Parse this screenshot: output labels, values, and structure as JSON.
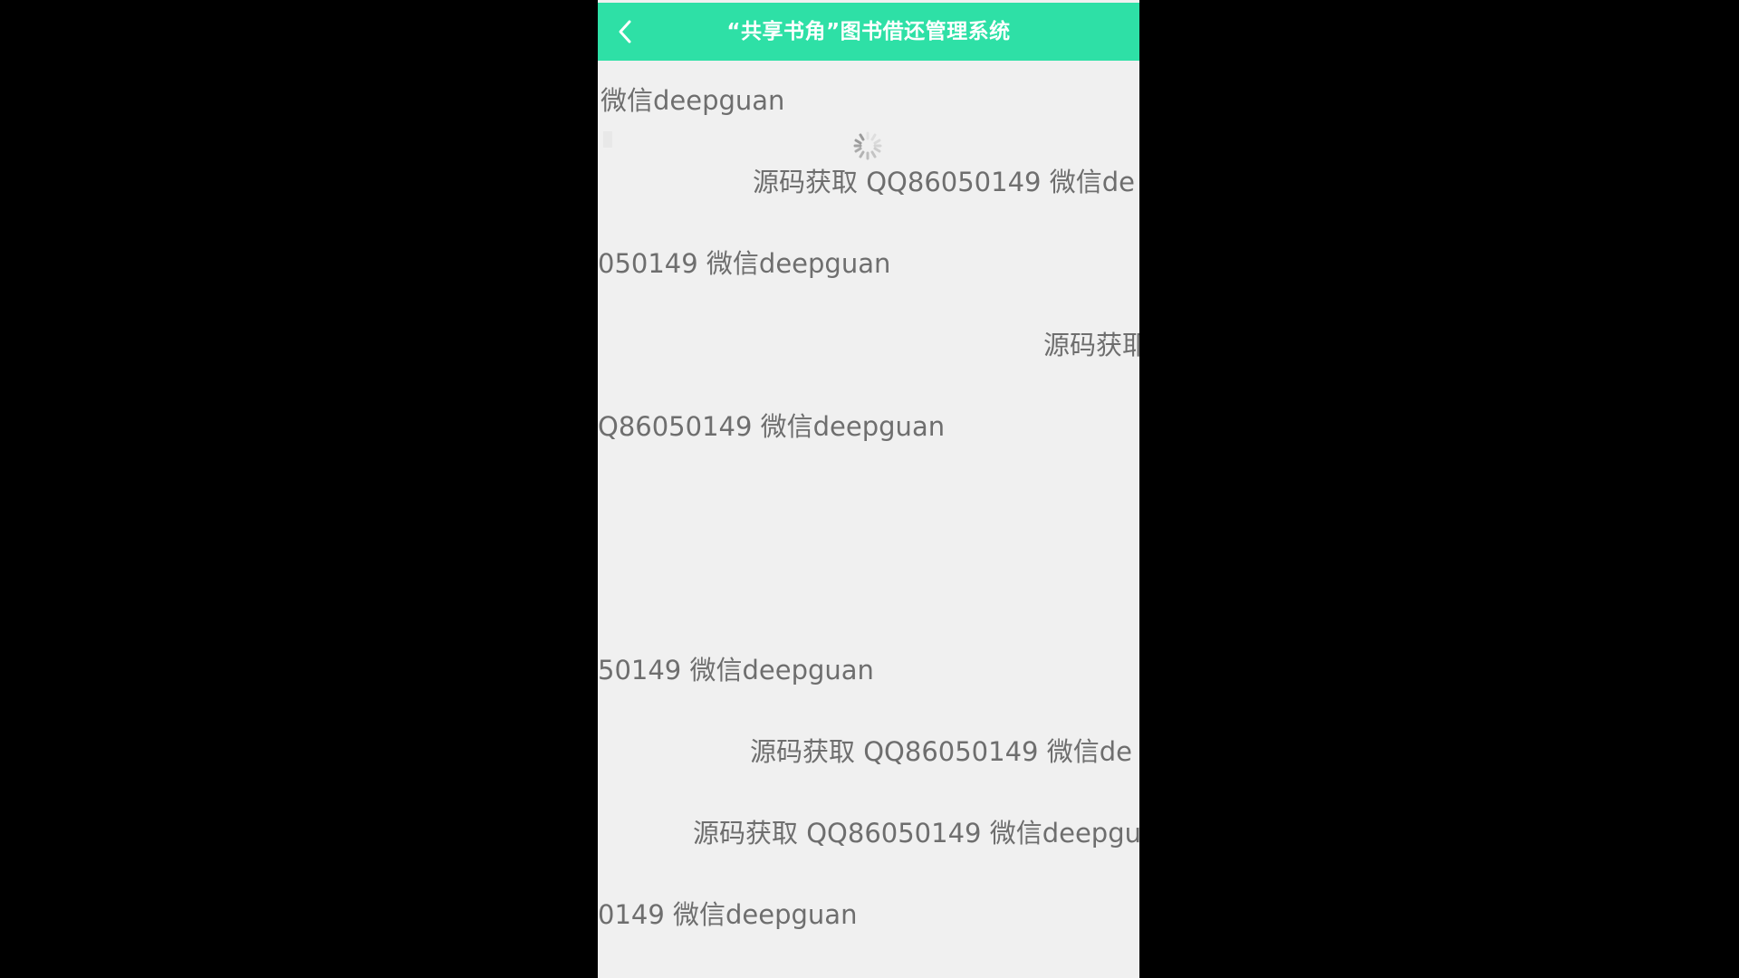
{
  "header": {
    "title": "“共享书角”图书借还管理系统",
    "back_icon": "chevron-left-icon"
  },
  "colors": {
    "header_bg": "#2ee0a6",
    "page_bg": "#f0f0f0",
    "watermark_text": "#6e6e6e"
  },
  "content": {
    "loading_icon": "spinner-icon",
    "watermarks": [
      "微信deepguan",
      "源码获取 QQ86050149 微信de",
      "050149 微信deepguan",
      "源码获耶",
      "Q86050149 微信deepguan",
      "50149 微信deepguan",
      "源码获取 QQ86050149 微信de",
      "源码获取 QQ86050149 微信deepgu",
      "0149 微信deepguan"
    ]
  }
}
